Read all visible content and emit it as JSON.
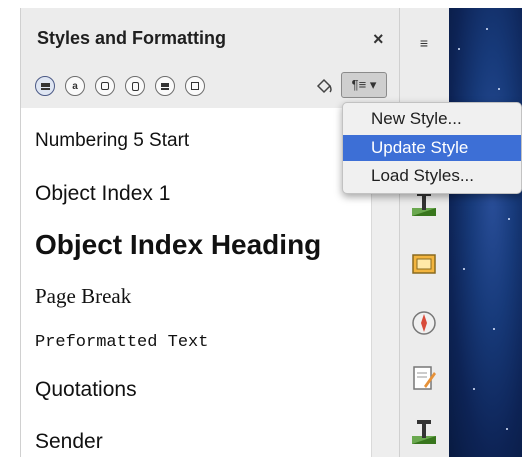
{
  "panel": {
    "title": "Styles and Formatting",
    "close_label": "×"
  },
  "toolbar": {
    "paragraph_styles_label": "",
    "character_styles_label": "a",
    "frame_styles_label": "",
    "page_styles_label": "",
    "list_styles_label": "",
    "table_styles_label": "",
    "new_style_menu_label": "¶≡ ▾"
  },
  "styles": [
    {
      "label": "Numbering 5 Start"
    },
    {
      "label": "Object Index 1"
    },
    {
      "label": "Object Index Heading"
    },
    {
      "label": "Page Break"
    },
    {
      "label": "Preformatted Text"
    },
    {
      "label": "Quotations"
    },
    {
      "label": "Sender"
    }
  ],
  "menu": {
    "items": [
      {
        "label": "New Style..."
      },
      {
        "label": "Update Style"
      },
      {
        "label": "Load Styles..."
      }
    ]
  },
  "sidebar": {
    "menu_label": "≡"
  },
  "colors": {
    "highlight": "#3d6fd6",
    "space_bg": "#173a7a"
  }
}
